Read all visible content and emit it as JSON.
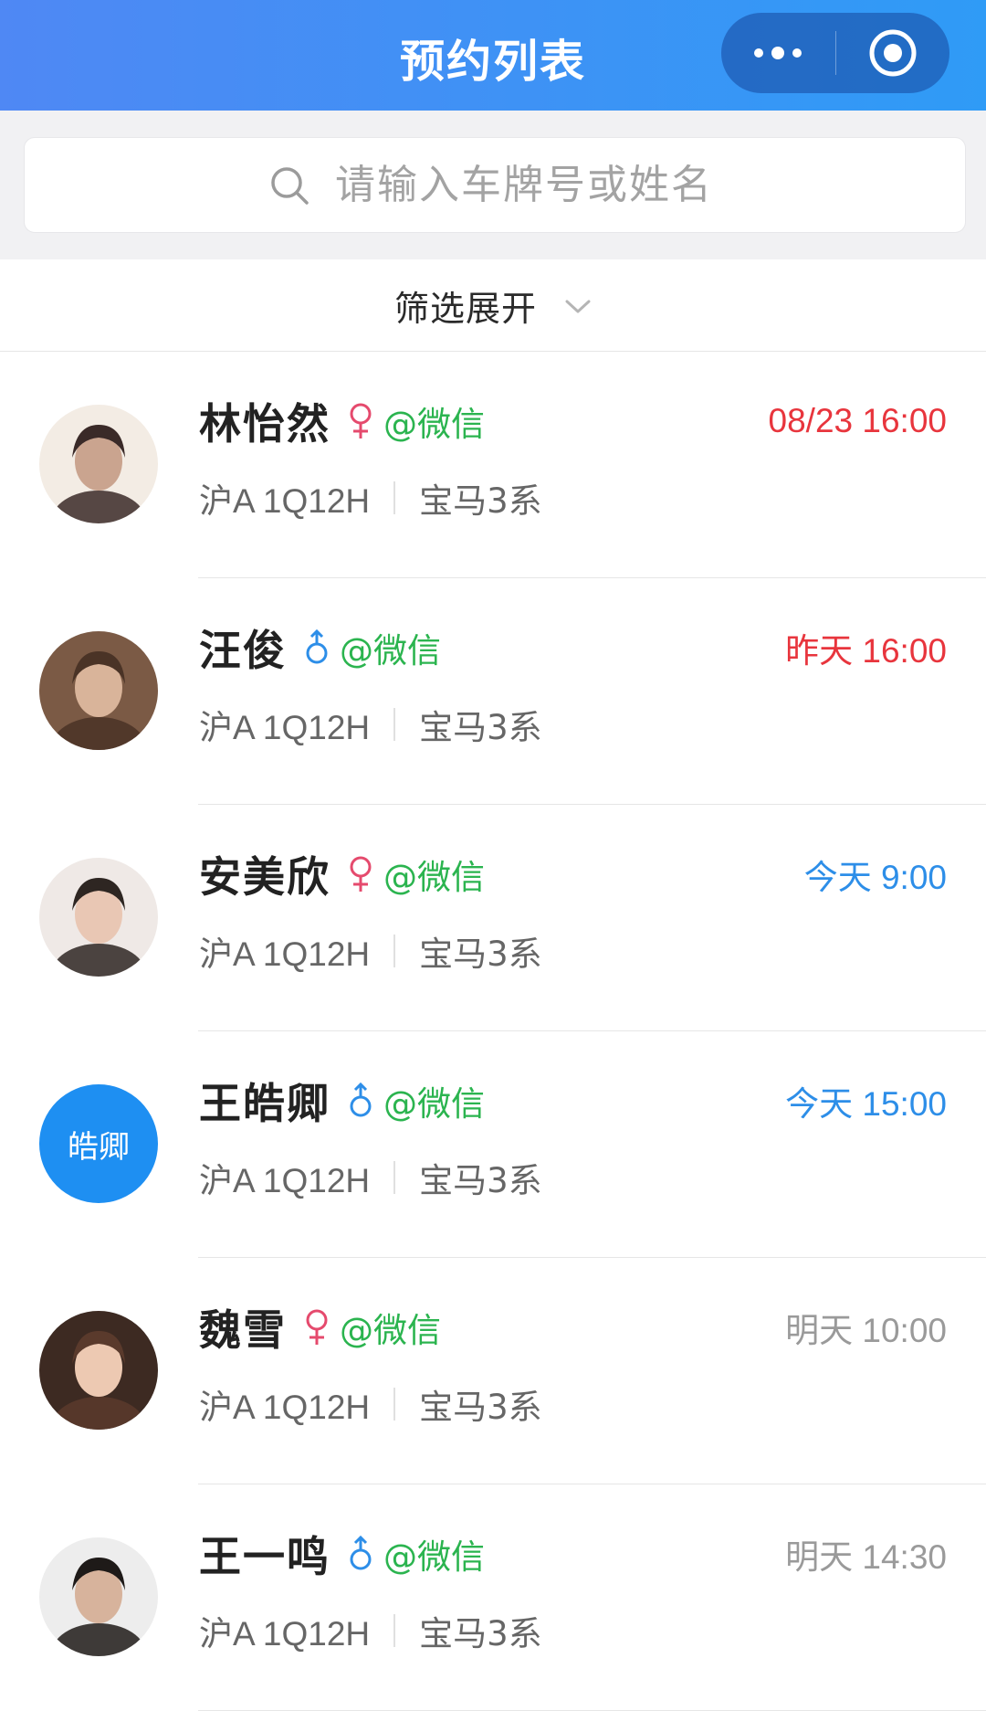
{
  "header": {
    "title": "预约列表",
    "more_icon": "more-dots-icon",
    "close_icon": "target-circle-icon"
  },
  "search": {
    "placeholder": "请输入车牌号或姓名",
    "icon": "search-icon"
  },
  "filter": {
    "label": "筛选展开",
    "icon": "chevron-down-icon"
  },
  "colors": {
    "header_start": "#4f88f4",
    "header_end": "#2f9bf6",
    "wechat_green": "#2bb44f",
    "female_pink": "#e54a6d",
    "male_blue": "#2d8ee8",
    "past_red": "#e8353d",
    "today_blue": "#2d8ee8",
    "future_gray": "#9a9a9a"
  },
  "items": [
    {
      "name": "林怡然",
      "gender": "female",
      "gender_icon": "female-icon",
      "source": "@微信",
      "time": "08/23 16:00",
      "time_status": "past",
      "plate": "沪A 1Q12H",
      "car": "宝马3系",
      "avatar": {
        "type": "photo",
        "icon": "avatar-photo-icon"
      }
    },
    {
      "name": "汪俊",
      "gender": "male",
      "gender_icon": "male-icon",
      "source": "@微信",
      "time": "昨天 16:00",
      "time_status": "past",
      "plate": "沪A 1Q12H",
      "car": "宝马3系",
      "avatar": {
        "type": "photo",
        "icon": "avatar-photo-icon"
      }
    },
    {
      "name": "安美欣",
      "gender": "female",
      "gender_icon": "female-icon",
      "source": "@微信",
      "time": "今天 9:00",
      "time_status": "today",
      "plate": "沪A 1Q12H",
      "car": "宝马3系",
      "avatar": {
        "type": "photo",
        "icon": "avatar-photo-icon"
      }
    },
    {
      "name": "王皓卿",
      "gender": "male",
      "gender_icon": "male-icon",
      "source": "@微信",
      "time": "今天 15:00",
      "time_status": "today",
      "plate": "沪A 1Q12H",
      "car": "宝马3系",
      "avatar": {
        "type": "text",
        "text": "皓卿"
      }
    },
    {
      "name": "魏雪",
      "gender": "female",
      "gender_icon": "female-icon",
      "source": "@微信",
      "time": "明天 10:00",
      "time_status": "future",
      "plate": "沪A 1Q12H",
      "car": "宝马3系",
      "avatar": {
        "type": "photo",
        "icon": "avatar-photo-icon"
      }
    },
    {
      "name": "王一鸣",
      "gender": "male",
      "gender_icon": "male-icon",
      "source": "@微信",
      "time": "明天 14:30",
      "time_status": "future",
      "plate": "沪A 1Q12H",
      "car": "宝马3系",
      "avatar": {
        "type": "photo",
        "icon": "avatar-photo-icon"
      }
    }
  ]
}
